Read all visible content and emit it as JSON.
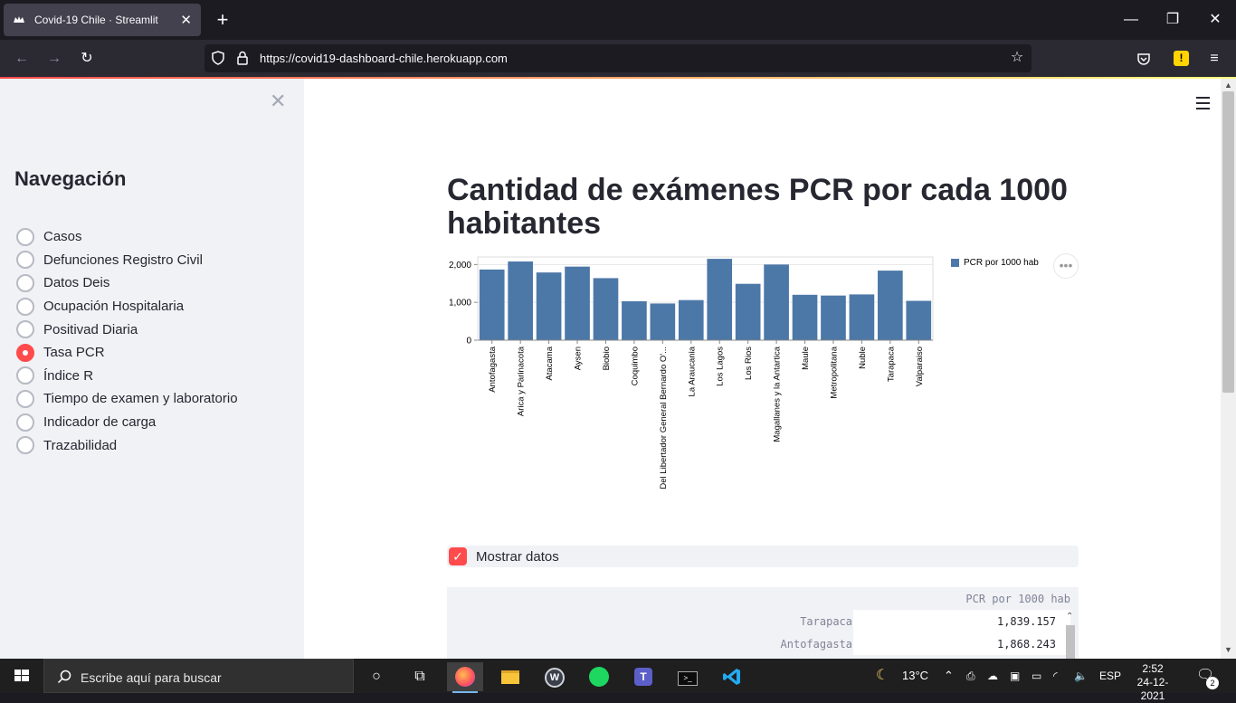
{
  "browser": {
    "tab_title": "Covid-19 Chile · Streamlit",
    "url": "https://covid19-dashboard-chile.herokuapp.com"
  },
  "sidebar": {
    "title": "Navegación",
    "options": [
      {
        "label": "Casos",
        "selected": false
      },
      {
        "label": "Defunciones Registro Civil",
        "selected": false
      },
      {
        "label": "Datos Deis",
        "selected": false
      },
      {
        "label": "Ocupación Hospitalaria",
        "selected": false
      },
      {
        "label": "Positivad Diaria",
        "selected": false
      },
      {
        "label": "Tasa PCR",
        "selected": true
      },
      {
        "label": "Índice R",
        "selected": false
      },
      {
        "label": "Tiempo de examen y laboratorio",
        "selected": false
      },
      {
        "label": "Indicador de carga",
        "selected": false
      },
      {
        "label": "Trazabilidad",
        "selected": false
      }
    ]
  },
  "main": {
    "title": "Cantidad de exámenes PCR por cada 1000 habitantes",
    "checkbox_label": "Mostrar datos",
    "checkbox_checked": true
  },
  "chart_data": {
    "type": "bar",
    "title": "",
    "xlabel": "",
    "ylabel": "",
    "ylim": [
      0,
      2200
    ],
    "yticks": [
      "0",
      "1,000",
      "2,000"
    ],
    "grid": true,
    "legend_position": "top-right",
    "categories": [
      "Antofagasta",
      "Arica y Parinacota",
      "Atacama",
      "Aysen",
      "Biobio",
      "Coquimbo",
      "Del Libertador General Bernardo O'...",
      "La Araucania",
      "Los Lagos",
      "Los Rios",
      "Magallanes y la Antartica",
      "Maule",
      "Metropolitana",
      "Nuble",
      "Tarapaca",
      "Valparaiso"
    ],
    "series": [
      {
        "name": "PCR por 1000 hab",
        "color": "#4c78a8",
        "values": [
          1868,
          2080,
          1790,
          1945,
          1640,
          1030,
          970,
          1060,
          2150,
          1490,
          2000,
          1200,
          1180,
          1210,
          1839,
          1040
        ]
      }
    ]
  },
  "table": {
    "column": "PCR por 1000 hab",
    "rows": [
      {
        "index": "Tarapaca",
        "value": "1,839.157"
      },
      {
        "index": "Antofagasta",
        "value": "1,868.243"
      }
    ]
  },
  "taskbar": {
    "search_placeholder": "Escribe aquí para buscar",
    "temperature": "13°C",
    "language": "ESP",
    "time": "2:52",
    "date": "24-12-2021",
    "notifications": "2"
  },
  "colors": {
    "accent": "#ff4b4b",
    "bar": "#4c78a8",
    "sidebar_bg": "#f0f2f6"
  }
}
